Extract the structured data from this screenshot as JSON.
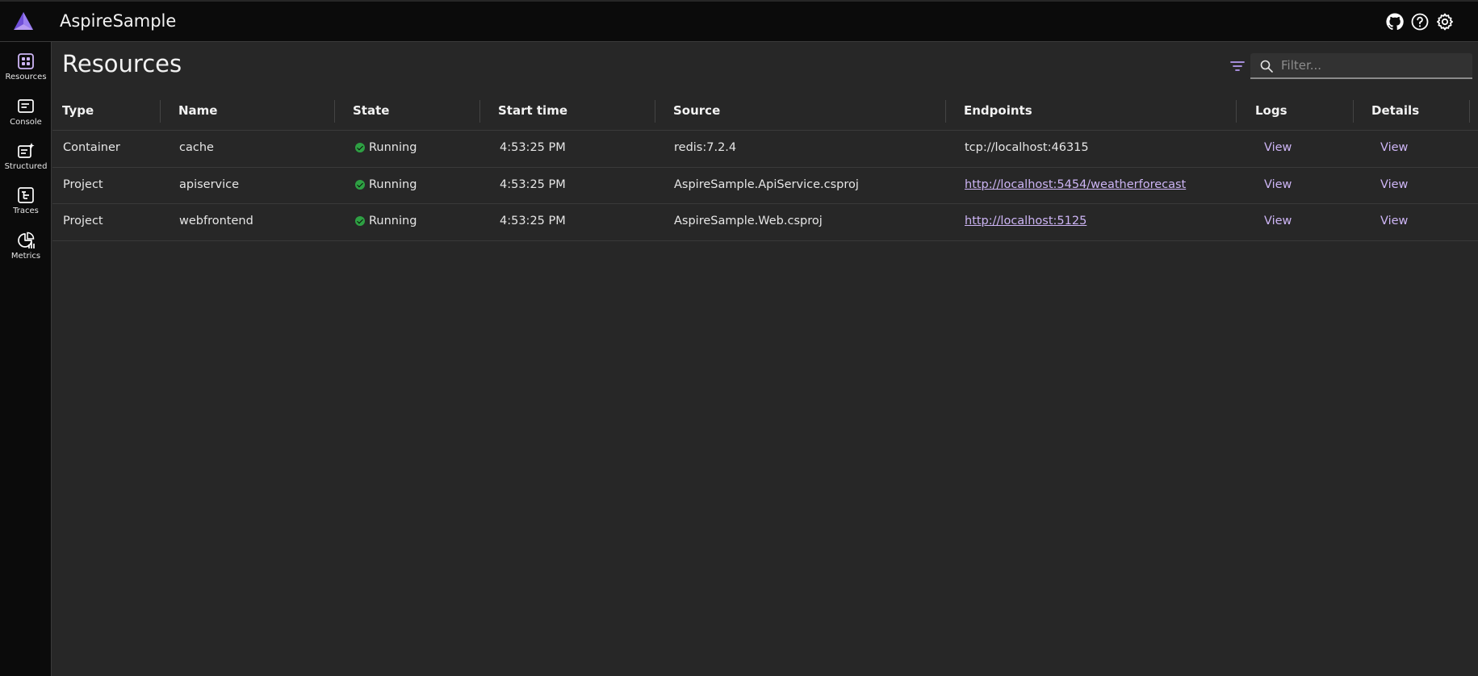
{
  "app": {
    "title": "AspireSample"
  },
  "colors": {
    "accent": "#b79bf2",
    "running": "#2ea043",
    "background": "#272727",
    "chrome": "#0b0b0b"
  },
  "header_icons": [
    "github-icon",
    "help-icon",
    "settings-icon"
  ],
  "sidebar": {
    "items": [
      {
        "label": "Resources",
        "icon": "resources-icon",
        "active": true
      },
      {
        "label": "Console",
        "icon": "console-icon"
      },
      {
        "label": "Structured",
        "icon": "structured-icon"
      },
      {
        "label": "Traces",
        "icon": "traces-icon"
      },
      {
        "label": "Metrics",
        "icon": "metrics-icon"
      }
    ]
  },
  "page": {
    "title": "Resources",
    "filter": {
      "placeholder": "Filter...",
      "value": ""
    }
  },
  "table": {
    "columns": [
      "Type",
      "Name",
      "State",
      "Start time",
      "Source",
      "Endpoints",
      "Logs",
      "Details"
    ],
    "rows": [
      {
        "type": "Container",
        "name": "cache",
        "state": "Running",
        "start_time": "4:53:25 PM",
        "source": "redis:7.2.4",
        "endpoint": "tcp://localhost:46315",
        "logs": "View",
        "details": "View"
      },
      {
        "type": "Project",
        "name": "apiservice",
        "state": "Running",
        "start_time": "4:53:25 PM",
        "source": "AspireSample.ApiService.csproj",
        "endpoint": "http://localhost:5454/weatherforecast",
        "logs": "View",
        "details": "View"
      },
      {
        "type": "Project",
        "name": "webfrontend",
        "state": "Running",
        "start_time": "4:53:25 PM",
        "source": "AspireSample.Web.csproj",
        "endpoint": "http://localhost:5125",
        "logs": "View",
        "details": "View"
      }
    ]
  }
}
